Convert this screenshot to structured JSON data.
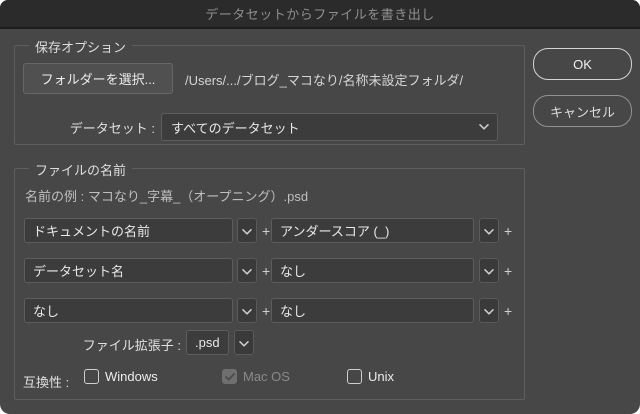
{
  "dialog": {
    "title": "データセットからファイルを書き出し"
  },
  "actions": {
    "ok_label": "OK",
    "cancel_label": "キャンセル"
  },
  "save_options": {
    "legend": "保存オプション",
    "choose_folder_label": "フォルダーを選択...",
    "folder_path": "/Users/.../ブログ_マコなり/名称未設定フォルダ/",
    "dataset_label": "データセット :",
    "dataset_value": "すべてのデータセット"
  },
  "file_name": {
    "legend": "ファイルの名前",
    "example": "名前の例 : マコなり_字幕_（オープニング）.psd",
    "plus": "+",
    "rows": [
      {
        "left": "ドキュメントの名前",
        "right": "アンダースコア (_)"
      },
      {
        "left": "データセット名",
        "right": "なし"
      },
      {
        "left": "なし",
        "right": "なし"
      }
    ],
    "extension_label": "ファイル拡張子 :",
    "extension_value": ".psd",
    "compatibility_label": "互換性 :",
    "compat_options": [
      {
        "label": "Windows",
        "checked": false,
        "disabled": false
      },
      {
        "label": "Mac OS",
        "checked": true,
        "disabled": true
      },
      {
        "label": "Unix",
        "checked": false,
        "disabled": false
      }
    ]
  },
  "colors": {
    "dialog_bg": "#474747",
    "titlebar_bg": "#2b2b2b",
    "field_bg": "#3c3c3c",
    "field_border": "#5d5d5d",
    "text_primary": "#e8e8e8",
    "text_dim": "#8f8f8f"
  }
}
